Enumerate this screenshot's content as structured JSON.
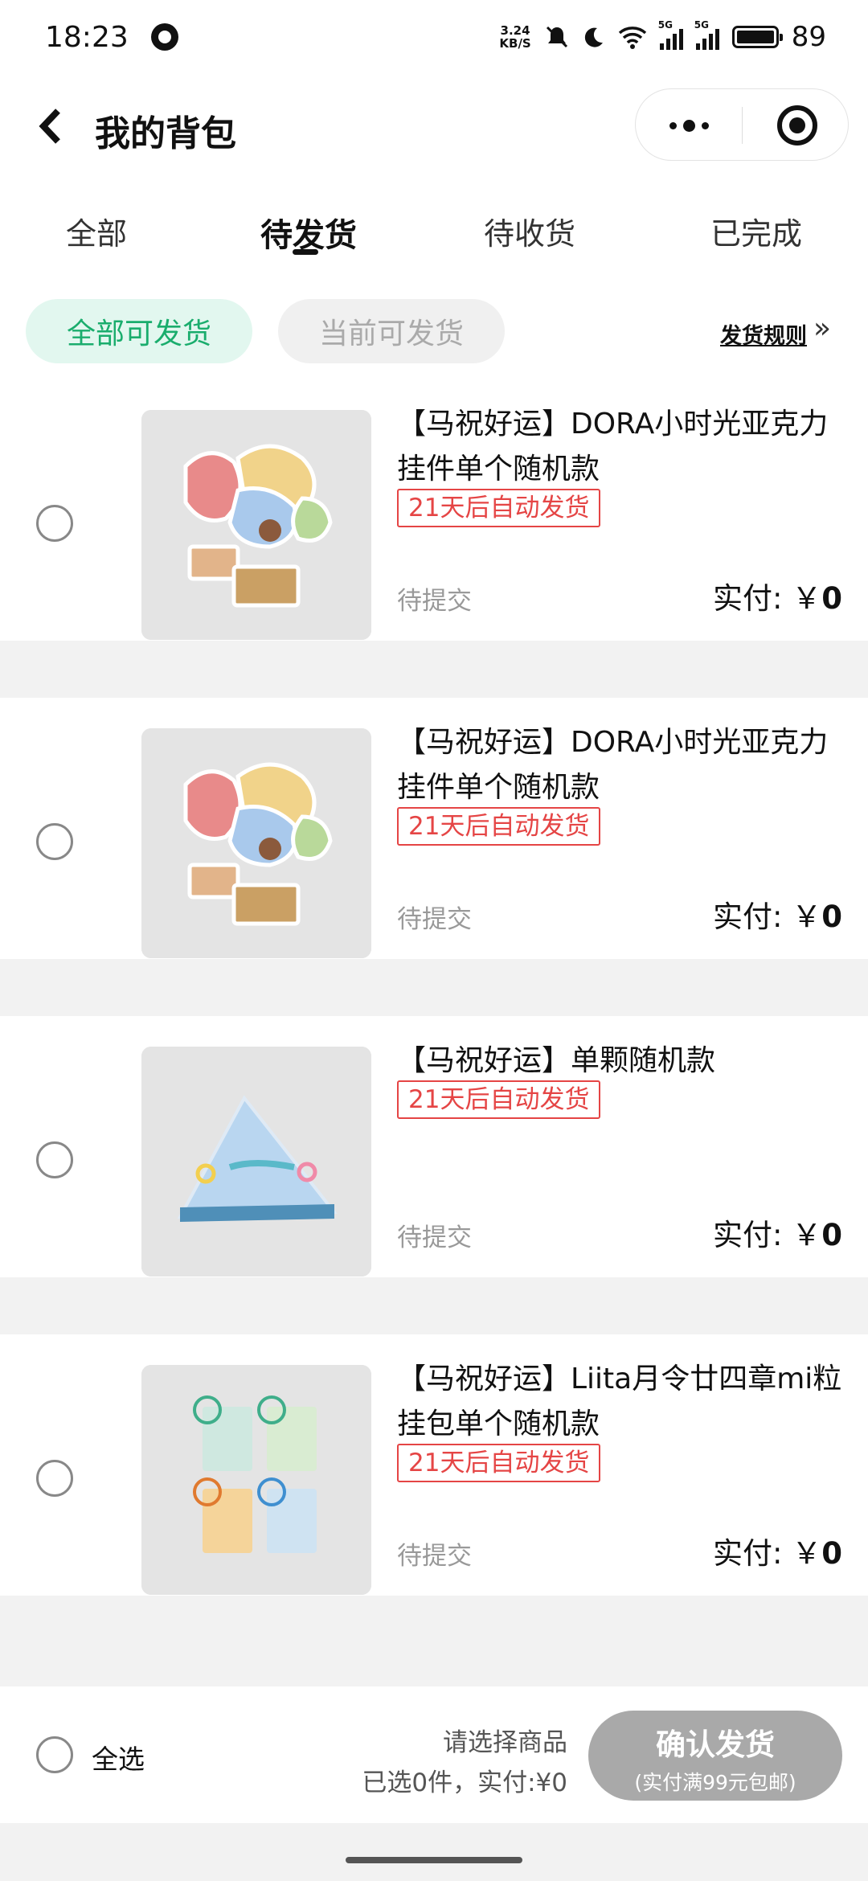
{
  "status_bar": {
    "time": "18:23",
    "speed_value": "3.24",
    "speed_unit": "KB/S",
    "signal_label_1": "5G",
    "signal_label_2": "5G",
    "battery_level": "89"
  },
  "header": {
    "title": "我的背包"
  },
  "tabs": [
    {
      "label": "全部"
    },
    {
      "label": "待发货"
    },
    {
      "label": "待收货"
    },
    {
      "label": "已完成"
    }
  ],
  "active_tab": "待发货",
  "filters": {
    "all_shippable": "全部可发货",
    "current_shippable": "当前可发货",
    "rules": "发货规则"
  },
  "items": [
    {
      "name": "【马祝好运】DORA小时光亚克力挂件单个随机款",
      "badge": "21天后自动发货",
      "status": "待提交",
      "price_label": "实付: ￥",
      "price_value": "0"
    },
    {
      "name": "【马祝好运】DORA小时光亚克力挂件单个随机款",
      "badge": "21天后自动发货",
      "status": "待提交",
      "price_label": "实付: ￥",
      "price_value": "0"
    },
    {
      "name": "【马祝好运】单颗随机款",
      "badge": "21天后自动发货",
      "status": "待提交",
      "price_label": "实付: ￥",
      "price_value": "0"
    },
    {
      "name": "【马祝好运】Liita月令廿四章mi粒挂包单个随机款",
      "badge": "21天后自动发货",
      "status": "待提交",
      "price_label": "实付: ￥",
      "price_value": "0"
    }
  ],
  "bottom": {
    "select_all": "全选",
    "hint": "请选择商品",
    "summary": "已选0件，实付:¥0",
    "confirm_label": "确认发货",
    "confirm_sub": "(实付满99元包邮)"
  },
  "colors": {
    "accent_green": "#1aad6d",
    "badge_red": "#e54545",
    "button_disabled": "#a9a9a9"
  }
}
